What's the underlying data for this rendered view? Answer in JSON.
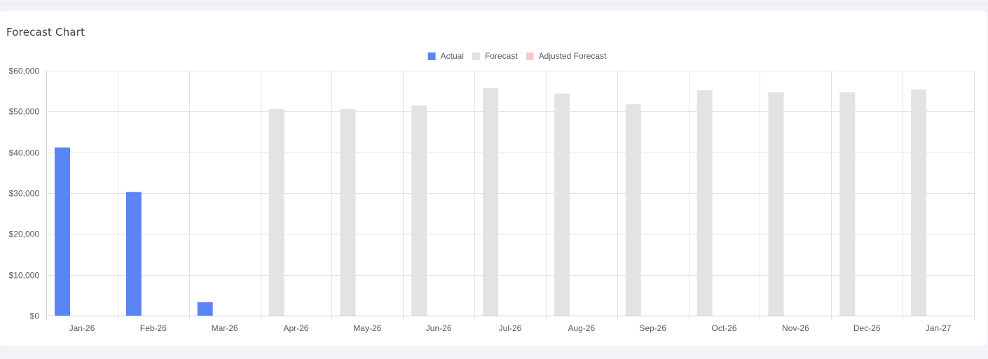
{
  "card": {
    "title": "Forecast Chart"
  },
  "chart_data": {
    "type": "bar",
    "title": "",
    "xlabel": "",
    "ylabel": "",
    "ylim": [
      0,
      60000
    ],
    "yticks": [
      0,
      10000,
      20000,
      30000,
      40000,
      50000,
      60000
    ],
    "ytick_labels": [
      "$0",
      "$10,000",
      "$20,000",
      "$30,000",
      "$40,000",
      "$50,000",
      "$60,000"
    ],
    "grid": true,
    "legend_position": "top-center",
    "categories": [
      "Jan-26",
      "Feb-26",
      "Mar-26",
      "Apr-26",
      "May-26",
      "Jun-26",
      "Jul-26",
      "Aug-26",
      "Sep-26",
      "Oct-26",
      "Nov-26",
      "Dec-26",
      "Jan-27"
    ],
    "series": [
      {
        "name": "Actual",
        "color": "#5b84f4",
        "values": [
          41200,
          30300,
          3300,
          null,
          null,
          null,
          null,
          null,
          null,
          null,
          null,
          null,
          null
        ]
      },
      {
        "name": "Forecast",
        "color": "#e3e3e3",
        "values": [
          null,
          null,
          null,
          50600,
          50600,
          51500,
          55700,
          54400,
          51800,
          55200,
          54700,
          54700,
          55400
        ]
      },
      {
        "name": "Adjusted Forecast",
        "color": "#f8c9c9",
        "values": [
          null,
          null,
          null,
          null,
          null,
          null,
          null,
          null,
          null,
          null,
          null,
          null,
          null
        ]
      }
    ]
  }
}
